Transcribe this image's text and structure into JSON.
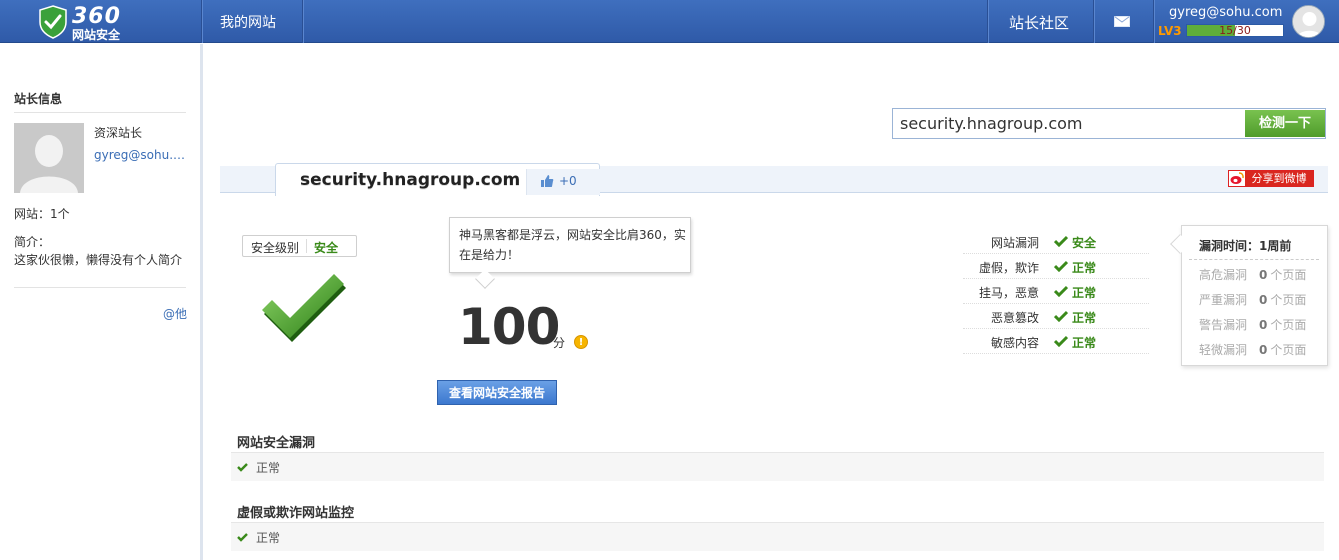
{
  "header": {
    "logo_main": "360",
    "logo_sub": "网站安全",
    "nav_mysite": "我的网站",
    "nav_community": "站长社区",
    "user_email": "gyreg@sohu.com",
    "level_label": "LV3",
    "level_progress_text": "15/30",
    "level_progress_fraction": 0.5,
    "mail_icon": "envelope-icon"
  },
  "sidebar": {
    "title": "站长信息",
    "rank": "资深站长",
    "email": "gyreg@sohu.com",
    "sites": "网站：1个",
    "intro_label": "简介：",
    "intro_text": "这家伙很懒，懒得没有个人简介",
    "at_link": "@他"
  },
  "search": {
    "value": "security.hnagroup.com",
    "button": "检测一下"
  },
  "domain": {
    "name": "security.hnagroup.com",
    "like_count": "+0",
    "share_label": "分享到微博"
  },
  "security": {
    "level_label": "安全级别",
    "level_value": "安全",
    "bubble_text": "神马黑客都是浮云，网站安全比肩360，实在是给力！",
    "score": "100",
    "score_unit": "分",
    "report_button": "查看网站安全报告"
  },
  "status_list": [
    {
      "label": "网站漏洞",
      "value": "安全"
    },
    {
      "label": "虚假，欺诈",
      "value": "正常"
    },
    {
      "label": "挂马，恶意",
      "value": "正常"
    },
    {
      "label": "恶意篡改",
      "value": "正常"
    },
    {
      "label": "敏感内容",
      "value": "正常"
    }
  ],
  "vuln_panel": {
    "title": "漏洞时间：1周前",
    "rows": [
      {
        "label": "高危漏洞",
        "count": "0",
        "unit": "个页面"
      },
      {
        "label": "严重漏洞",
        "count": "0",
        "unit": "个页面"
      },
      {
        "label": "警告漏洞",
        "count": "0",
        "unit": "个页面"
      },
      {
        "label": "轻微漏洞",
        "count": "0",
        "unit": "个页面"
      }
    ]
  },
  "sections": [
    {
      "title": "网站安全漏洞",
      "status": "正常"
    },
    {
      "title": "虚假或欺诈网站监控",
      "status": "正常"
    }
  ],
  "colors": {
    "header_blue": "#3a66b4",
    "ok_green": "#3a8a1a",
    "button_green": "#5fae3a",
    "link_blue": "#3a6db5"
  }
}
